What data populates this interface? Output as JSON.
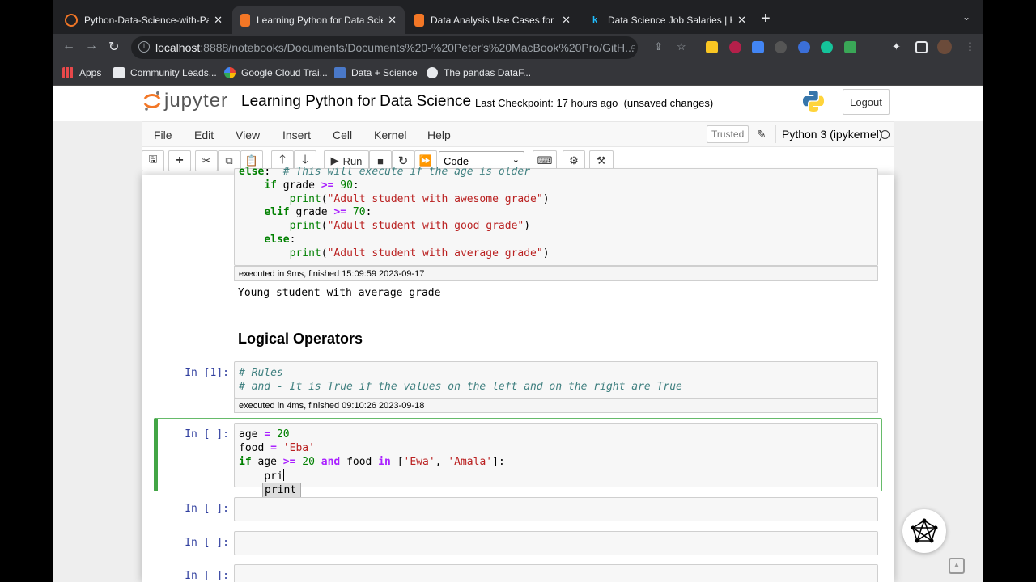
{
  "browser": {
    "tabs": [
      {
        "label": "Python-Data-Science-with-Pa",
        "active": false
      },
      {
        "label": "Learning Python for Data Scien",
        "active": true
      },
      {
        "label": "Data Analysis Use Cases for Py",
        "active": false
      },
      {
        "label": "Data Science Job Salaries | Ka",
        "active": false
      }
    ],
    "url_host": "localhost",
    "url_path": ":8888/notebooks/Documents/Documents%20-%20Peter's%20MacBook%20Pro/GitH...",
    "bookmarks": [
      "Apps",
      "Community Leads...",
      "Google Cloud Trai...",
      "Data + Science",
      "The pandas DataF..."
    ]
  },
  "jupyter": {
    "logo_text": "jupyter",
    "notebook_title": "Learning Python for Data Science",
    "checkpoint": "Last Checkpoint: 17 hours ago",
    "unsaved": "(unsaved changes)",
    "logout_label": "Logout",
    "menu": [
      "File",
      "Edit",
      "View",
      "Insert",
      "Cell",
      "Kernel",
      "Help"
    ],
    "trusted_label": "Trusted",
    "kernel_name": "Python 3 (ipykernel)",
    "toolbar": {
      "run_label": "Run",
      "cell_type": "Code"
    }
  },
  "cells": {
    "cell1_exec": "executed in 9ms, finished 15:09:59 2023-09-17",
    "cell1_output": "Young student with average grade",
    "heading": "Logical Operators",
    "cell2_prompt": "In [1]:",
    "cell2_exec": "executed in 4ms, finished 09:10:26 2023-09-18",
    "cell3_prompt": "In [ ]:",
    "cell4_prompt": "In [ ]:",
    "cell5_prompt": "In [ ]:",
    "cell6_prompt": "In [ ]:",
    "autocomplete": "print"
  },
  "colors": {
    "jupyter_orange": "#f37726",
    "selected_cell_border": "#42a545",
    "prompt_blue": "#303f9f"
  }
}
